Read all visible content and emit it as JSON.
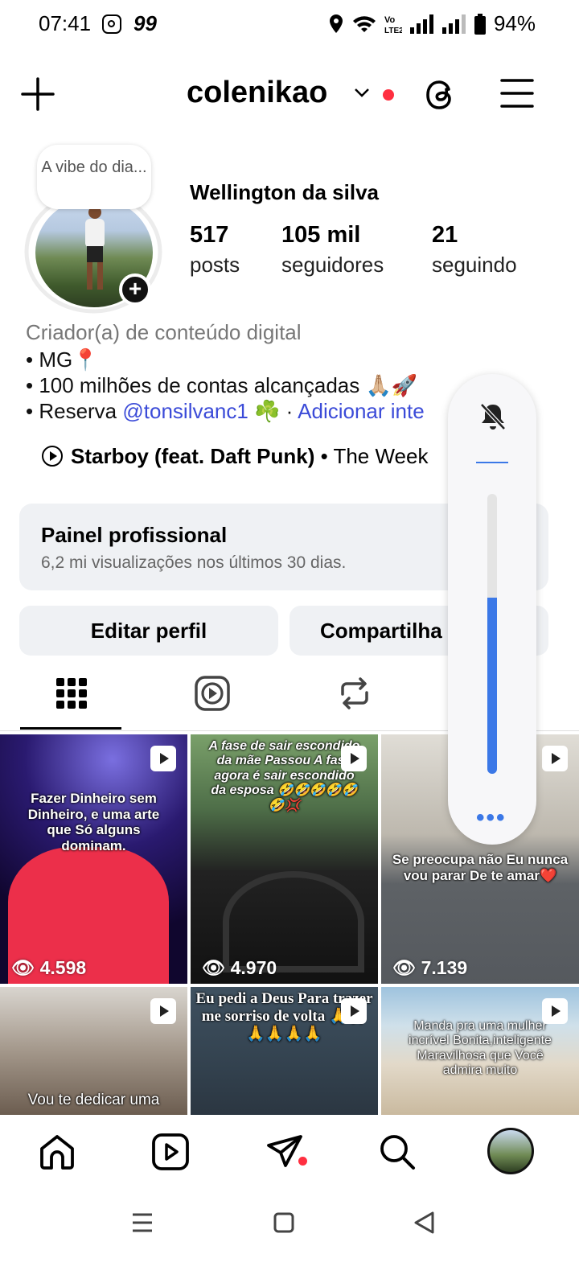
{
  "status_bar": {
    "time": "07:41",
    "notif_count": "99",
    "battery": "94%"
  },
  "header": {
    "username": "colenikao"
  },
  "profile": {
    "note": "A vibe do dia...",
    "full_name": "Wellington da silva",
    "stats": [
      {
        "value": "517",
        "label": "posts"
      },
      {
        "value": "105 mil",
        "label": "seguidores"
      },
      {
        "value": "21",
        "label": "seguindo"
      }
    ],
    "category": "Criador(a) de conteúdo digital",
    "bio_lines": [
      "• MG📍",
      "• 100 milhões de contas alcançadas 🙏🏼🚀"
    ],
    "bio_reserva_prefix": "• Reserva ",
    "bio_mention": "@tonsilvanc1",
    "bio_clover": " ☘️ · ",
    "bio_add_link": "Adicionar inte",
    "music_title": "Starboy (feat. Daft Punk)",
    "music_artist": " • The Week"
  },
  "dashboard": {
    "title": "Painel profissional",
    "subtitle": "6,2 mi visualizações nos últimos 30 dias."
  },
  "buttons": {
    "edit": "Editar perfil",
    "share": "Compartilha"
  },
  "tabs": [
    "grid-icon",
    "reels-icon",
    "reposts-icon"
  ],
  "grid": [
    {
      "caption": "Fazer Dinheiro sem Dinheiro, e uma arte que Só alguns dominam.",
      "views": "4.598"
    },
    {
      "caption": "A fase de sair escondido da mãe Passou A fase agora é sair escondido da esposa 🤣🤣🤣🤣🤣🤣💢",
      "views": "4.970"
    },
    {
      "caption": "Se preocupa não Eu nunca vou parar De te amar❤️",
      "views": "7.139"
    },
    {
      "caption": "Vou te dedicar uma",
      "views": ""
    },
    {
      "caption": "Eu pedi a Deus Para trazer me sorriso de volta 🙏🙏🙏🙏🙏🙏",
      "views": ""
    },
    {
      "caption": "Manda pra uma mulher incrível Bonita,inteligente Maravilhosa que Você admira muito",
      "views": ""
    }
  ],
  "volume": {
    "level": 0.63
  },
  "colors": {
    "accent_red": "#ff2f40",
    "link_blue": "#3b4bd8",
    "volume_blue": "#3b78e7",
    "card_bg": "#eff1f4"
  }
}
